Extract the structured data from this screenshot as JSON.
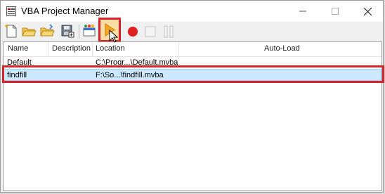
{
  "window": {
    "title": "VBA Project Manager"
  },
  "toolbar": {
    "buttons": [
      {
        "name": "new-project-button",
        "icon": "new-document-icon"
      },
      {
        "name": "open-project-button",
        "icon": "open-folder-icon"
      },
      {
        "name": "load-project-button",
        "icon": "load-folder-icon"
      },
      {
        "name": "save-project-button",
        "icon": "save-as-icon"
      },
      {
        "name": "vba-editor-button",
        "icon": "vba-editor-icon"
      },
      {
        "name": "run-macro-button",
        "icon": "play-icon"
      },
      {
        "name": "record-macro-button",
        "icon": "record-icon"
      },
      {
        "name": "stop-recording-button",
        "icon": "stop-icon"
      },
      {
        "name": "pause-recording-button",
        "icon": "pause-icon"
      }
    ]
  },
  "list": {
    "columns": [
      "Name",
      "Description",
      "Location",
      "Auto-Load"
    ],
    "rows": [
      {
        "name": "Default",
        "description": "",
        "location": "C:\\Progr...\\Default.mvba",
        "autoload": ""
      },
      {
        "name": "findfill",
        "description": "",
        "location": "F:\\So...\\findfill.mvba",
        "autoload": ""
      }
    ]
  },
  "colors": {
    "highlight": "#d9232a",
    "selection": "#cce8ff",
    "play": "#f5a623",
    "record": "#e02020"
  }
}
